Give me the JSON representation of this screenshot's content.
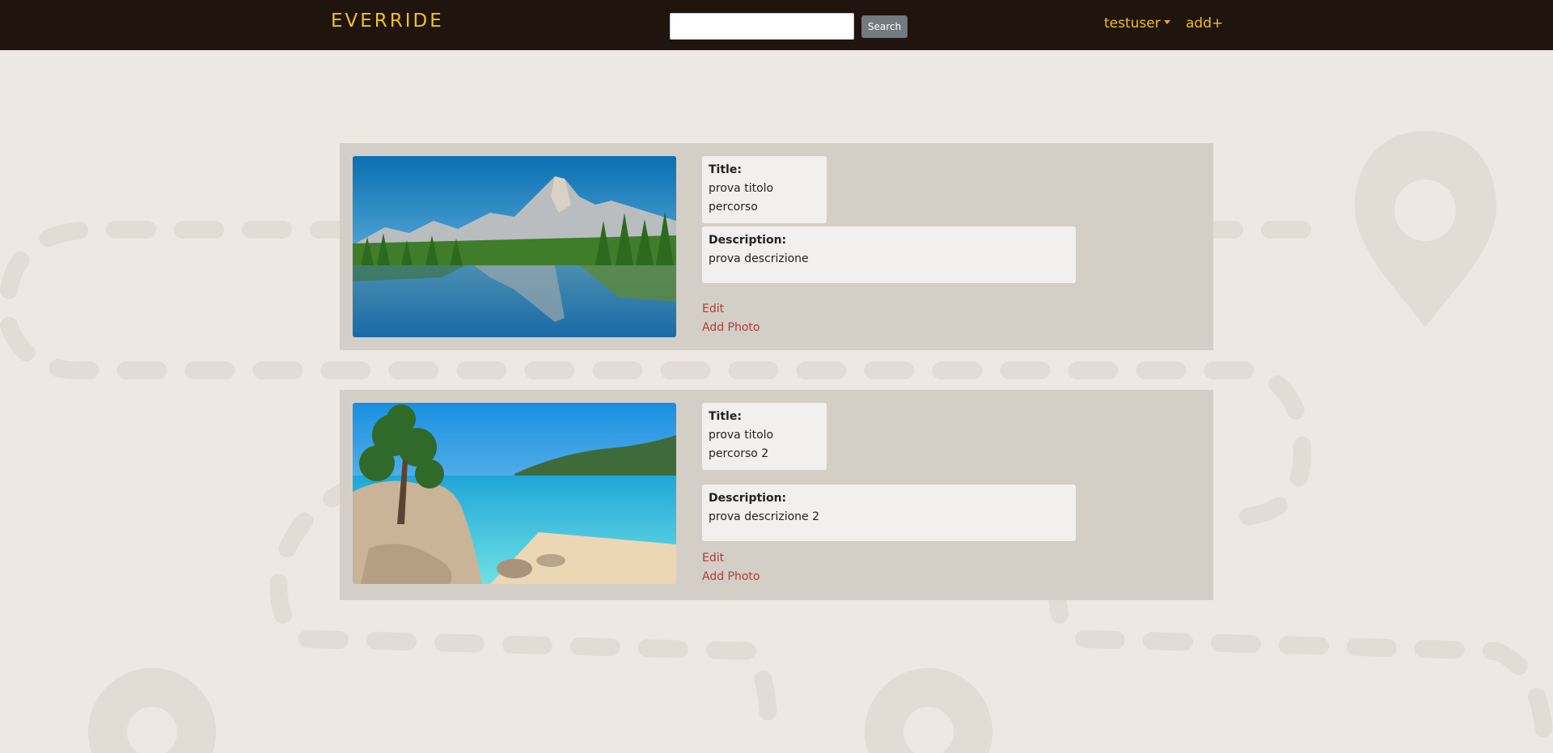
{
  "navbar": {
    "brand": "EVERRIDE",
    "search_value": "",
    "search_button": "Search",
    "user_menu": "testuser",
    "add_link": "add+"
  },
  "routes": [
    {
      "title_label": "Title:",
      "title": "prova titolo percorso",
      "description_label": "Description:",
      "description": "prova descrizione",
      "edit": "Edit",
      "add_photo": "Add Photo"
    },
    {
      "title_label": "Title:",
      "title": "prova titolo percorso 2",
      "description_label": "Description:",
      "description": "prova descrizione 2",
      "edit": "Edit",
      "add_photo": "Add Photo"
    }
  ],
  "colors": {
    "navbar": "#1f140e",
    "accent": "#f0c020",
    "page_background": "#ede8e2",
    "card_background": "#d3cfc7",
    "link": "#b23a35"
  }
}
